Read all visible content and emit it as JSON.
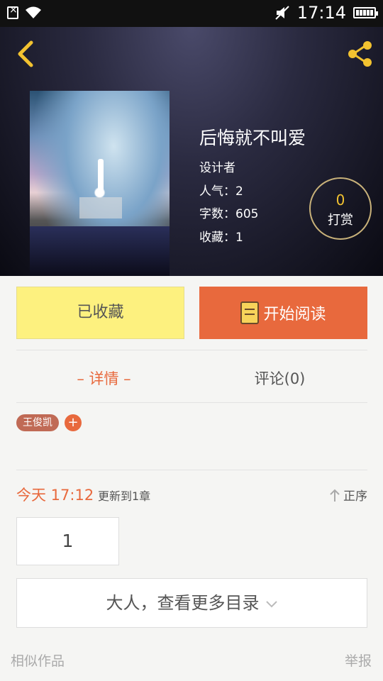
{
  "status": {
    "time": "17:14"
  },
  "book": {
    "title": "后悔就不叫爱",
    "author": "设计者",
    "popularity": "人气：2",
    "word_count": "字数：605",
    "favorites": "收藏：1"
  },
  "tip": {
    "count": "0",
    "label": "打赏"
  },
  "actions": {
    "favorited_label": "已收藏",
    "read_label": "开始阅读"
  },
  "tabs": {
    "detail": "– 详情 –",
    "comments": "评论(0)"
  },
  "tags": {
    "items": [
      "王俊凯"
    ],
    "add_symbol": "+"
  },
  "update": {
    "date": "今天 17:12",
    "text": "更新到1章",
    "sort_label": "正序"
  },
  "chapters": {
    "first": "1",
    "more_label": "大人，查看更多目录"
  },
  "footer": {
    "similar": "相似作品",
    "report": "举报"
  },
  "colors": {
    "accent": "#e8693d",
    "favorite_bg": "#fdf17f",
    "gold": "#f2c230"
  },
  "icons": {
    "back": "chevron-left-icon",
    "share": "share-icon",
    "book": "book-icon",
    "sort": "arrow-up-icon"
  }
}
